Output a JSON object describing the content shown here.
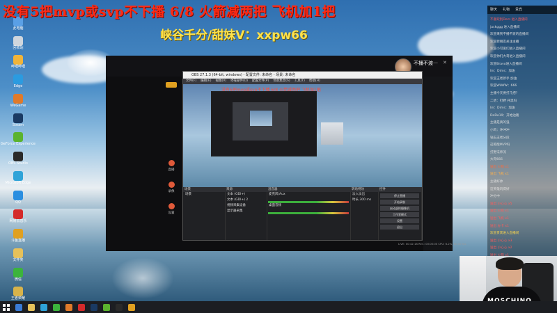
{
  "overlay": {
    "headline": "没有5把mvp或svp不下播 6/8 火箭减两把 飞机加1把",
    "subline": "峡谷千分/甜妹V：xxpw66"
  },
  "desktop_icons": [
    {
      "label": "此电脑",
      "color": "#5aa0e6"
    },
    {
      "label": "回收站",
      "color": "#cfd6dd"
    },
    {
      "label": "哔哩哔哩",
      "color": "#f0b43a"
    },
    {
      "label": "Edge",
      "color": "#2b9be0"
    },
    {
      "label": "WeGame",
      "color": "#e07a2a"
    },
    {
      "label": "Steam",
      "color": "#1a3a63"
    },
    {
      "label": "GeForce Experience",
      "color": "#5bb32e"
    },
    {
      "label": "OBS Studio",
      "color": "#2a2a2a"
    },
    {
      "label": "Microsoft Edge",
      "color": "#2fa3d8"
    },
    {
      "label": "QQ",
      "color": "#2a8ee0"
    },
    {
      "label": "网易云音乐",
      "color": "#d42a2a"
    },
    {
      "label": "斗鱼直播",
      "color": "#e0a020"
    },
    {
      "label": "文件夹",
      "color": "#e6c15a"
    },
    {
      "label": "微信",
      "color": "#3cb43c"
    },
    {
      "label": "王者荣耀",
      "color": "#d8b34a"
    }
  ],
  "window": {
    "streamer_name": "不播不渡",
    "obs_title": "OBS 27.1.3 (64-bit, windows) - 配置文件: 未命名 - 场景: 未命名",
    "obs_menu": [
      "文件(F)",
      "编辑(E)",
      "视图(V)",
      "停靠部件(D)",
      "配置文件(P)",
      "场景集合(S)",
      "工具(T)",
      "帮助(H)"
    ],
    "docks": [
      {
        "title": "场景",
        "items": [
          "场景"
        ]
      },
      {
        "title": "来源",
        "items": [
          "文本 (GDI+)",
          "文本 (GDI+) 2",
          "视频采集设备",
          "显示器采集"
        ]
      },
      {
        "title": "混音器",
        "items": [
          "麦克风/Aux",
          "桌面音频"
        ]
      },
      {
        "title": "转场特效",
        "items": [
          "淡入淡出",
          "时长 300 ms"
        ]
      },
      {
        "title": "控件",
        "items": [
          "停止直播",
          "开始录制",
          "启动虚拟摄像机",
          "工作室模式",
          "设置",
          "退出"
        ]
      }
    ],
    "left_sidebar": [
      "直播",
      "录像",
      "设置"
    ],
    "status": "LIVE: 00:42:18   REC: 00:00:00   CPU: 6.2%, 60.00 fps"
  },
  "chat": {
    "tabs": [
      "聊天",
      "礼物",
      "贵宾"
    ],
    "lines": [
      {
        "text": "不喜欢别Dem 进入直播间",
        "color": "#ff5a5a"
      },
      {
        "text": "jackggg 进入直播间",
        "color": "#dddddd"
      },
      {
        "text": "欢迎来到不播不渡的直播间",
        "color": "#dddddd"
      },
      {
        "text": "欢迎新朋友关注主播",
        "color": "#dddddd"
      },
      {
        "text": "欢迎小可爱们进入直播间",
        "color": "#dddddd"
      },
      {
        "text": "欢迎你们大哥进入直播间",
        "color": "#dddddd"
      },
      {
        "text": "欢迎Bravo进入直播间",
        "color": "#dddddd"
      },
      {
        "text": "lin：Dims：加油",
        "color": "#dddddd"
      },
      {
        "text": "欢迎王者新手 加油",
        "color": "#dddddd"
      },
      {
        "text": "欢迎WLWW：666",
        "color": "#dddddd"
      },
      {
        "text": "主播今天要打几把？",
        "color": "#dddddd"
      },
      {
        "text": "二哈：打野 开黑吗",
        "color": "#dddddd"
      },
      {
        "text": "lin：Dims：加油",
        "color": "#dddddd"
      },
      {
        "text": "DoDo19：开始边路",
        "color": "#dddddd"
      },
      {
        "text": "主播是真的强",
        "color": "#dddddd"
      },
      {
        "text": "小鸡：冲冲冲",
        "color": "#dddddd"
      },
      {
        "text": "钻石王者分段",
        "color": "#dddddd"
      },
      {
        "text": "这把能MVP吗",
        "color": "#dddddd"
      },
      {
        "text": "打野法师流",
        "color": "#dddddd"
      },
      {
        "text": "大哥666",
        "color": "#dddddd"
      },
      {
        "text": "送出 火箭 x1",
        "color": "#ff6a3a"
      },
      {
        "text": "送出 飞机 x1",
        "color": "#ffb04a"
      },
      {
        "text": "主播好帅",
        "color": "#dddddd"
      },
      {
        "text": "这英雄玩得好",
        "color": "#dddddd"
      },
      {
        "text": "冲分中",
        "color": "#dddddd"
      },
      {
        "text": "送出 小心心 x5",
        "color": "#ff5a5a"
      },
      {
        "text": "送出 火箭 x1",
        "color": "#ff5a5a"
      },
      {
        "text": "送出 飞机 x1",
        "color": "#ff5a5a"
      },
      {
        "text": "送出 办卡 x1",
        "color": "#ff5a5a"
      },
      {
        "text": "欢迎贵宾进入直播间",
        "color": "#ffd84a"
      },
      {
        "text": "送出 小心心 x3",
        "color": "#ff5a5a"
      },
      {
        "text": "送出 小心心 x2",
        "color": "#ff5a5a"
      },
      {
        "text": "送出 火箭 x1",
        "color": "#ff5a5a"
      }
    ]
  },
  "webcam": {
    "shirt_text": "MOSCHINO"
  },
  "colors": {
    "headline": "#ff2a14",
    "subline": "#ffe24a",
    "chat_gift": "#ff5a5a"
  }
}
